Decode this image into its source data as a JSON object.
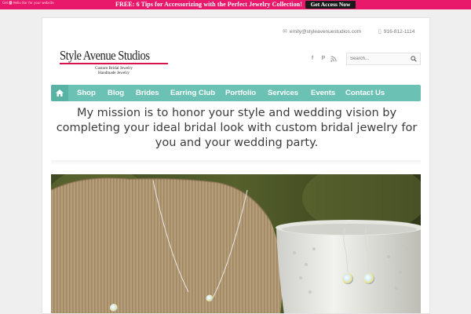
{
  "hellobar": {
    "tag": "Get 🅷 Hello Bar for your website",
    "text": "FREE: 6 Tips for Accessorizing with the Perfect Jewelry Collection!",
    "button": "Get Access Now",
    "color": "#e8196b"
  },
  "contact": {
    "email": "emily@styleavenuestudios.com",
    "phone": "916-812-1114"
  },
  "logo": {
    "title": "Style Avenue Studios",
    "subtitle1": "Custom Bridal Jewelry",
    "subtitle2": "Handmade Jewelry",
    "accent": "#d8124f"
  },
  "social": {
    "facebook": "f",
    "pinterest": "P",
    "rss": "rss"
  },
  "search": {
    "placeholder": "Search..."
  },
  "nav": {
    "color": "#6bc2b4",
    "items": [
      "Shop",
      "Blog",
      "Brides",
      "Earring Club",
      "Portfolio",
      "Services",
      "Events",
      "Contact Us"
    ]
  },
  "mission": {
    "line1": "My mission is to honor your style and wedding vision by",
    "line2": "completing your ideal bridal look with custom bridal jewelry for",
    "line3": "you and your wedding party."
  }
}
